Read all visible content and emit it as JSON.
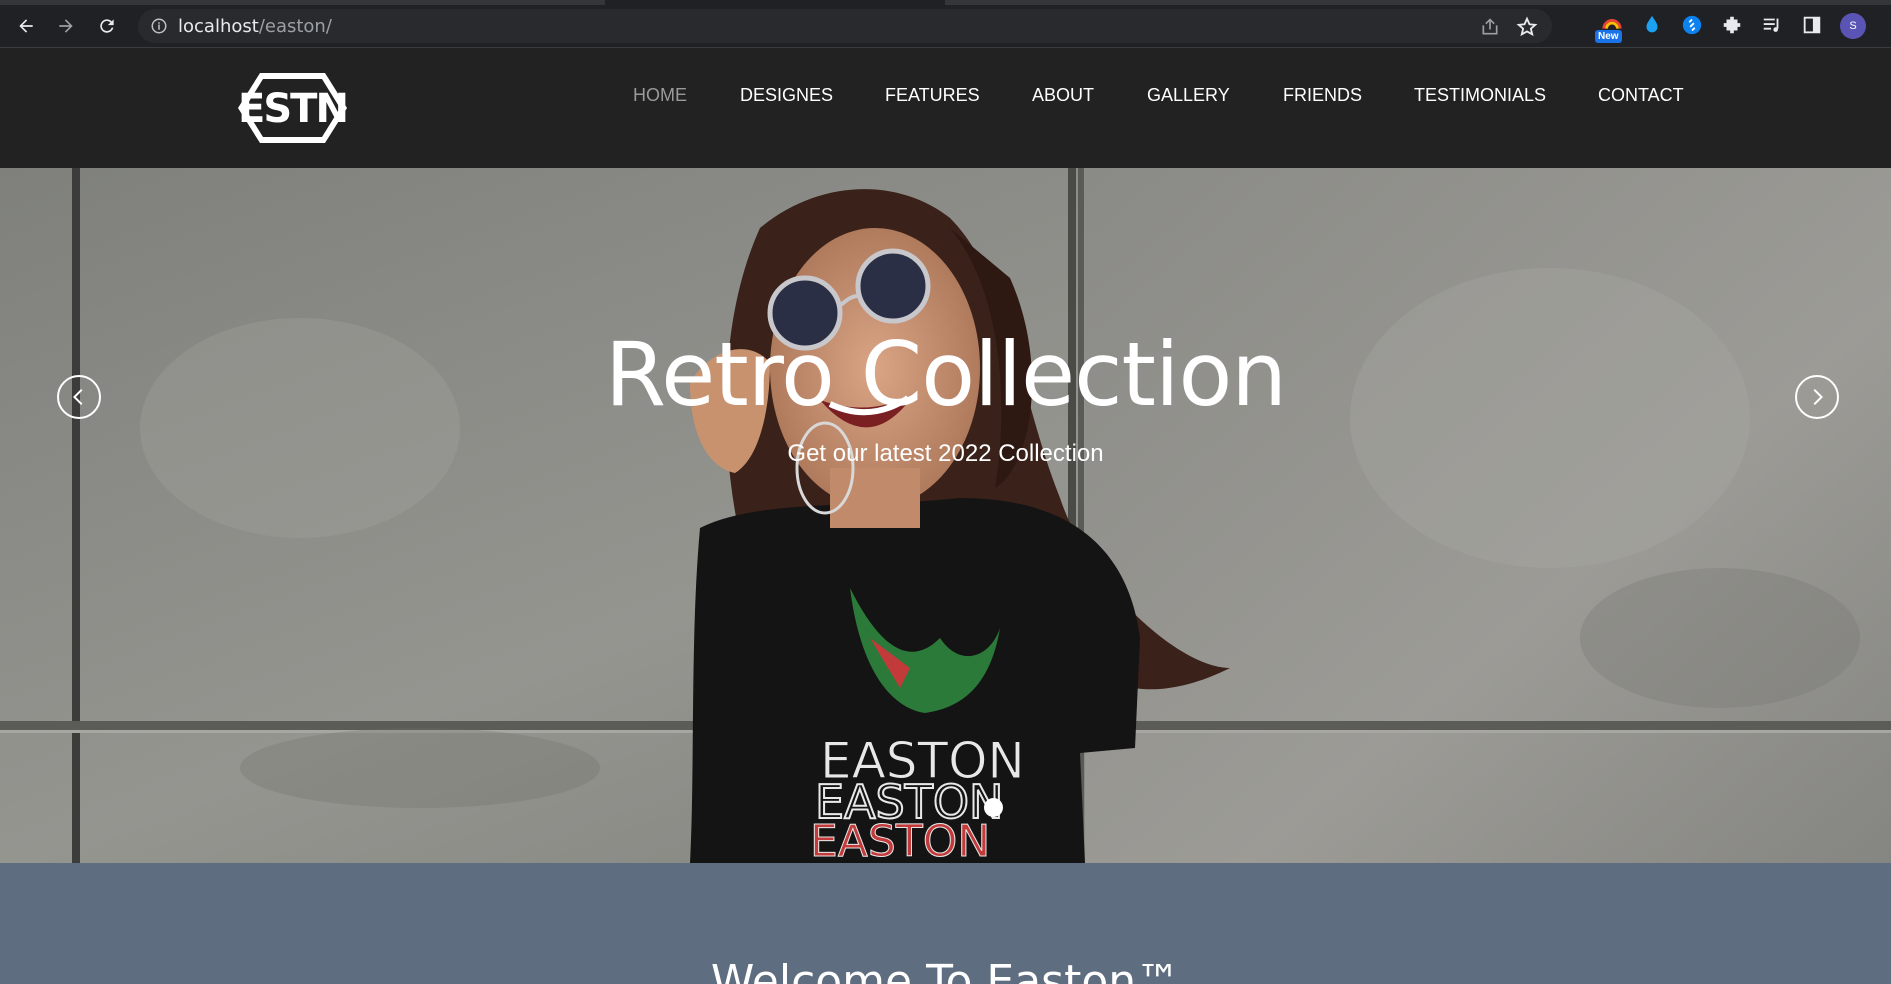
{
  "browser": {
    "url_host": "localhost",
    "url_path": "/easton/",
    "new_badge": "New",
    "profile_initial": "S"
  },
  "site": {
    "logo_text": "ESTN",
    "nav": [
      {
        "label": "HOME",
        "active": true
      },
      {
        "label": "DESIGNES"
      },
      {
        "label": "FEATURES"
      },
      {
        "label": "ABOUT"
      },
      {
        "label": "GALLERY"
      },
      {
        "label": "FRIENDS"
      },
      {
        "label": "TESTIMONIALS"
      },
      {
        "label": "CONTACT"
      }
    ]
  },
  "hero": {
    "title": "Retro Collection",
    "subtitle": "Get our latest 2022 Collection",
    "slide_count": 1,
    "active_slide": 1
  },
  "welcome": {
    "heading": "Welcome To Easton™"
  },
  "colors": {
    "header_bg": "#222222",
    "welcome_bg": "#5e6d80",
    "nav_active": "#9a9a9a"
  }
}
